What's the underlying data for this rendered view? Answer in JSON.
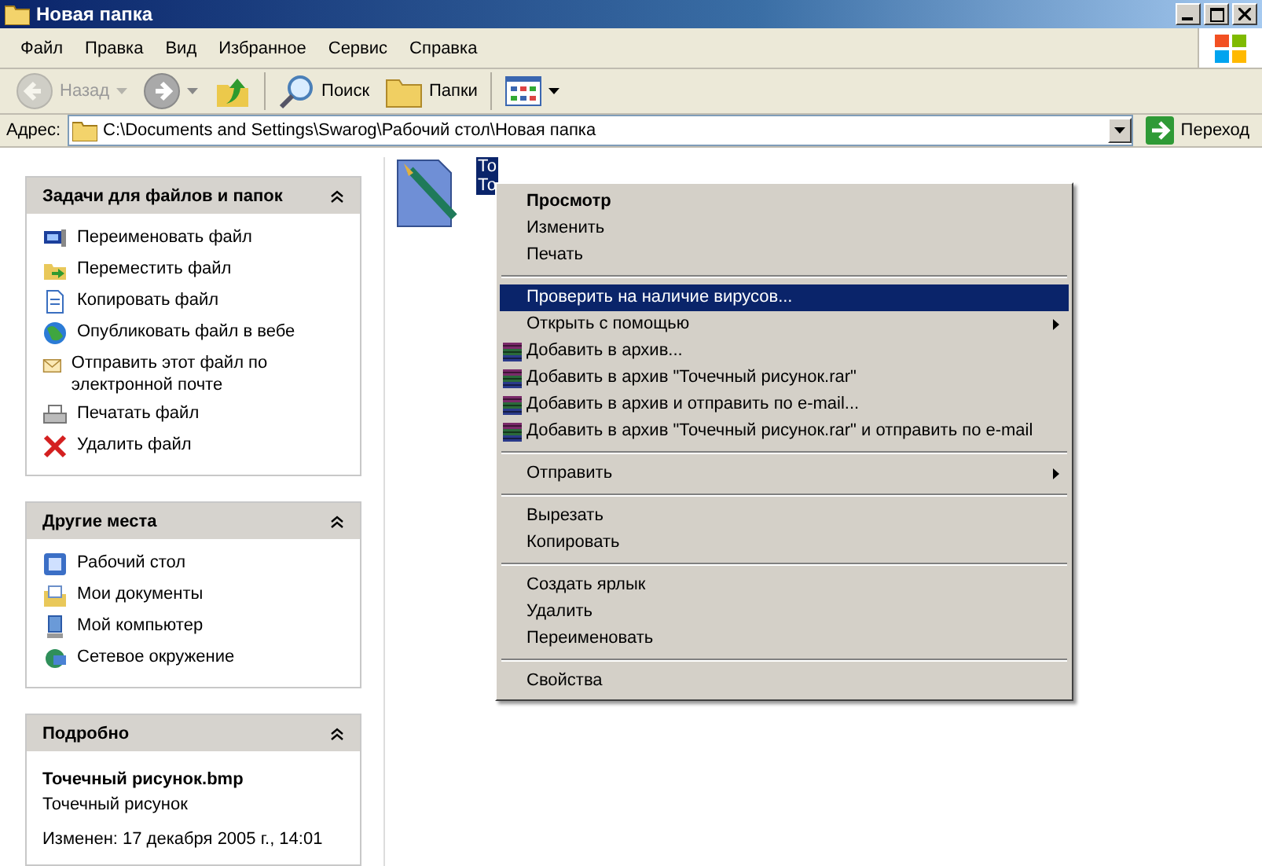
{
  "window": {
    "title": "Новая папка"
  },
  "menu_bar": [
    "Файл",
    "Правка",
    "Вид",
    "Избранное",
    "Сервис",
    "Справка"
  ],
  "toolbar": [
    {
      "kind": "back",
      "label": "Назад",
      "disabled": true
    },
    {
      "kind": "forward",
      "disabled": false
    },
    {
      "kind": "up",
      "disabled": false
    },
    {
      "kind": "search",
      "label": "Поиск",
      "disabled": false
    },
    {
      "kind": "folders",
      "label": "Папки",
      "disabled": false
    },
    {
      "kind": "views",
      "disabled": false
    }
  ],
  "address_bar": {
    "label": "Адрес:",
    "value": "C:\\Documents and Settings\\Swarog\\Рабочий стол\\Новая папка",
    "go_button": "Переход"
  },
  "task_panels": [
    {
      "kind": "links",
      "title": "Задачи для файлов и папок",
      "expanded": true,
      "items": [
        "Переименовать файл",
        "Переместить файл",
        "Копировать файл",
        "Опубликовать файл в вебе",
        "Отправить этот файл по электронной почте",
        "Печатать файл",
        "Удалить файл"
      ]
    },
    {
      "kind": "places",
      "title": "Другие места",
      "expanded": true,
      "items": [
        "Рабочий стол",
        "Мои документы",
        "Мой компьютер",
        "Сетевое окружение"
      ]
    },
    {
      "kind": "details",
      "title": "Подробно",
      "expanded": true,
      "name": "Точечный рисунок.bmp",
      "type": "Точечный рисунок",
      "modified": "Изменен: 17 декабря 2005 г., 14:01"
    }
  ],
  "file": {
    "label_lines": [
      "То",
      "То"
    ],
    "selected": true
  },
  "context_menu": {
    "groups": [
      [
        {
          "label": "Просмотр",
          "kind": "plain",
          "bold": true,
          "selected": false,
          "submenu": false
        },
        {
          "label": "Изменить",
          "kind": "plain",
          "bold": false,
          "selected": false,
          "submenu": false
        },
        {
          "label": "Печать",
          "kind": "plain",
          "bold": false,
          "selected": false,
          "submenu": false
        }
      ],
      [
        {
          "label": "Проверить на наличие вирусов...",
          "kind": "plain",
          "bold": false,
          "selected": true,
          "submenu": false
        },
        {
          "label": "Открыть с помощью",
          "kind": "plain",
          "bold": false,
          "selected": false,
          "submenu": true
        },
        {
          "label": "Добавить в архив...",
          "kind": "archive",
          "bold": false,
          "selected": false,
          "submenu": false
        },
        {
          "label": "Добавить в архив \"Точечный рисунок.rar\"",
          "kind": "archive",
          "bold": false,
          "selected": false,
          "submenu": false
        },
        {
          "label": "Добавить в архив и отправить по e-mail...",
          "kind": "archive",
          "bold": false,
          "selected": false,
          "submenu": false
        },
        {
          "label": "Добавить в архив \"Точечный рисунок.rar\" и отправить по e-mail",
          "kind": "archive",
          "bold": false,
          "selected": false,
          "submenu": false
        }
      ],
      [
        {
          "label": "Отправить",
          "kind": "plain",
          "bold": false,
          "selected": false,
          "submenu": true
        }
      ],
      [
        {
          "label": "Вырезать",
          "kind": "plain",
          "bold": false,
          "selected": false,
          "submenu": false
        },
        {
          "label": "Копировать",
          "kind": "plain",
          "bold": false,
          "selected": false,
          "submenu": false
        }
      ],
      [
        {
          "label": "Создать ярлык",
          "kind": "plain",
          "bold": false,
          "selected": false,
          "submenu": false
        },
        {
          "label": "Удалить",
          "kind": "plain",
          "bold": false,
          "selected": false,
          "submenu": false
        },
        {
          "label": "Переименовать",
          "kind": "plain",
          "bold": false,
          "selected": false,
          "submenu": false
        }
      ],
      [
        {
          "label": "Свойства",
          "kind": "plain",
          "bold": false,
          "selected": false,
          "submenu": false
        }
      ]
    ]
  }
}
